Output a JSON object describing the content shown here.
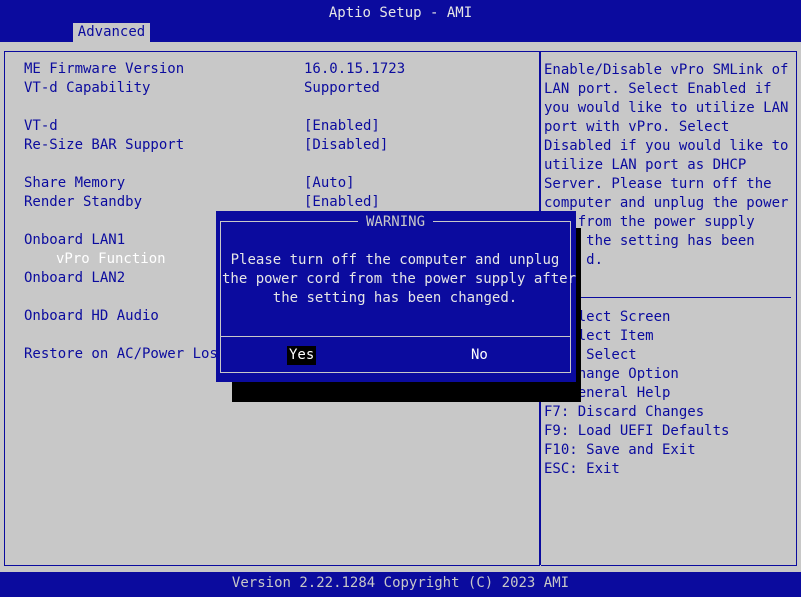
{
  "app": {
    "title": "Aptio Setup - AMI",
    "footer": "Version 2.22.1284 Copyright (C) 2023 AMI"
  },
  "tabs": [
    {
      "label": "Advanced",
      "active": true
    }
  ],
  "settings": [
    {
      "label": "ME Firmware Version",
      "value": "16.0.15.1723"
    },
    {
      "label": "VT-d Capability",
      "value": "Supported"
    },
    {
      "label": "VT-d",
      "value": "[Enabled]"
    },
    {
      "label": "Re-Size BAR Support",
      "value": "[Disabled]"
    },
    {
      "label": "Share Memory",
      "value": "[Auto]"
    },
    {
      "label": "Render Standby",
      "value": "[Enabled]"
    },
    {
      "label": "Onboard LAN1",
      "value": ""
    },
    {
      "label": "vPro Function",
      "value": ""
    },
    {
      "label": "Onboard LAN2",
      "value": ""
    },
    {
      "label": "Onboard HD Audio",
      "value": ""
    },
    {
      "label": "Restore on AC/Power Loss",
      "value": ""
    }
  ],
  "help": {
    "description": [
      "Enable/Disable vPro SMLink of",
      "LAN port. Select Enabled if",
      "you would like to utilize LAN",
      "port with vPro. Select",
      "Disabled if you would like to",
      "utilize LAN port as DHCP",
      "Server. Please turn off the",
      "computer and unplug the power",
      "    from the power supply",
      "     the setting has been",
      "     d."
    ],
    "keys": [
      "    lect Screen",
      "    lect Item",
      "     Select",
      "    hange Option",
      "    eneral Help",
      "F7: Discard Changes",
      "F9: Load UEFI Defaults",
      "F10: Save and Exit",
      "ESC: Exit"
    ]
  },
  "dialog": {
    "title": "WARNING",
    "message": "Please turn off the computer and unplug\nthe power cord from the power supply after\nthe setting has been changed.",
    "yes_label": "Yes",
    "no_label": "No",
    "selected": "Yes"
  },
  "colors": {
    "bios_blue": "#0b0b9e",
    "bios_gray": "#c8c8c8"
  }
}
